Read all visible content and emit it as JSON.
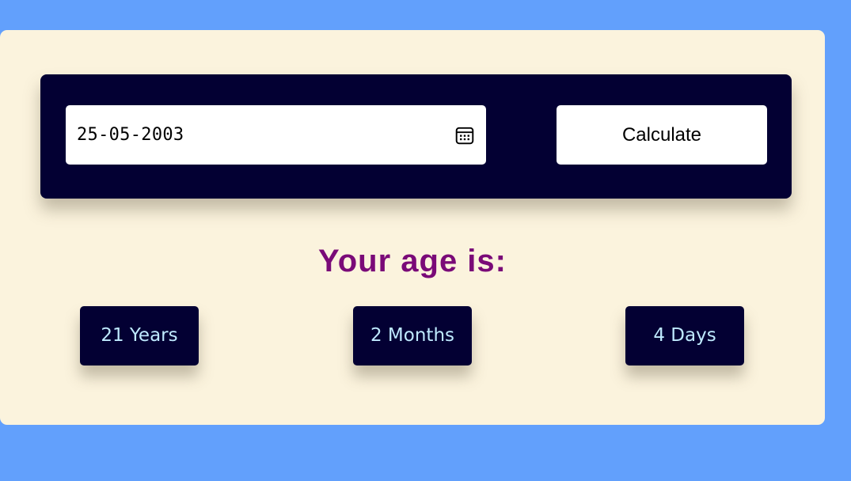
{
  "form": {
    "date_value": "25-05-2003",
    "calendar_icon": "calendar-icon",
    "calculate_label": "Calculate"
  },
  "result": {
    "heading": "Your age is:",
    "years": "21 Years",
    "months": "2 Months",
    "days": "4 Days"
  },
  "colors": {
    "page_background": "#62a0fc",
    "card_background": "#fbf3dd",
    "panel_background": "#030033",
    "heading_color": "#7a0a78",
    "result_text": "#bfeaff"
  }
}
